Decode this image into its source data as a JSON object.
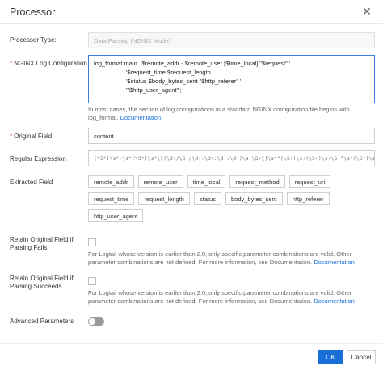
{
  "dialog": {
    "title": "Processor",
    "close_icon": "close-icon"
  },
  "processor_type": {
    "label": "Processor Type:",
    "value": "Data Parsing (NGINX Mode)"
  },
  "nginx_config": {
    "label": "NGINX Log Configuration",
    "lines": [
      "log_format main  '$remote_addr - $remote_user [$time_local] \"$request\" '",
      "'$request_time $request_length '",
      "'$status $body_bytes_sent \"$http_referer\" '",
      "'\"$http_user_agent\"';"
    ],
    "help_text": "In most cases, the section of log configurations in a standard NGINX configuration file begins with log_format.",
    "help_link": "Documentation"
  },
  "original_field": {
    "label": "Original Field",
    "value": "content"
  },
  "regular_expression": {
    "label": "Regular Expression",
    "value": "(\\S*)\\s*-\\s*(\\S*)\\s*\\[(\\d+/\\S+/\\d+:\\d+:\\d+:\\d+)\\s+\\S+\\]\\s*\"(\\S+)\\s+(\\S+)\\s+\\S+\"\\s*(\\S*)\\s*(\\S*)\\s*(\\S*)\\s*(\\S*)\\s*\"([^\"]*)\"\\s*\"([^\"]*)\".*"
  },
  "extracted_field": {
    "label": "Extracted Field",
    "tags": [
      "remote_addr",
      "remote_user",
      "time_local",
      "request_method",
      "request_uri",
      "request_time",
      "request_length",
      "status",
      "body_bytes_sent",
      "http_referer",
      "http_user_agent"
    ]
  },
  "retain_fail": {
    "label_line1": "Retain Original Field if",
    "label_line2": "Parsing Fails",
    "help_text": "For Logtail whose version is earlier than 2.0, only specific parameter combinations are valid. Other parameter combinations are not defined. For more information, see Documentation.",
    "help_link": "Documentation"
  },
  "retain_success": {
    "label_line1": "Retain Original Field if",
    "label_line2": "Parsing Succeeds",
    "help_text": "For Logtail whose version is earlier than 2.0, only specific parameter combinations are valid. Other parameter combinations are not defined. For more information, see Documentation.",
    "help_link": "Documentation"
  },
  "advanced": {
    "label": "Advanced Parameters"
  },
  "footer": {
    "ok_label": "OK",
    "cancel_label": "Cancel"
  }
}
